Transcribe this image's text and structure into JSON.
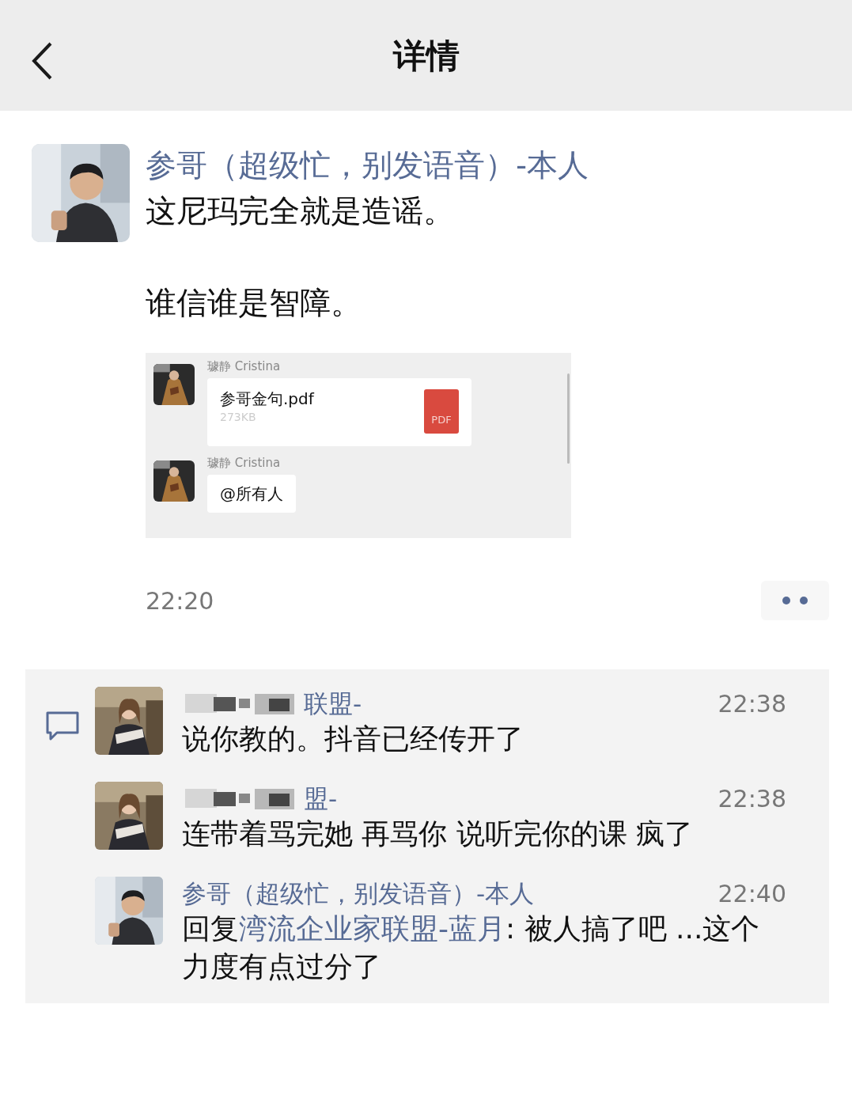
{
  "header": {
    "title": "详情"
  },
  "post": {
    "author": "参哥（超级忙，别发语音）-本人",
    "paragraphs": [
      "这尼玛完全就是造谣。",
      "谁信谁是智障。"
    ],
    "screenshot": {
      "messages": [
        {
          "kind": "file",
          "sender": "璩静 Cristina",
          "file_name": "参哥金句.pdf",
          "file_size": "273KB",
          "file_badge": "PDF"
        },
        {
          "kind": "text",
          "sender": "璩静 Cristina",
          "text": "@所有人"
        }
      ]
    },
    "time": "22:20"
  },
  "comments": [
    {
      "kind": "plain",
      "name": "联盟-",
      "name_blurred": true,
      "time": "22:38",
      "text": "说你教的。抖音已经传开了"
    },
    {
      "kind": "plain",
      "name": "盟-",
      "name_blurred": true,
      "time": "22:38",
      "text": "连带着骂完她 再骂你 说听完你的课 疯了"
    },
    {
      "kind": "reply",
      "name": "参哥（超级忙，别发语音）-本人",
      "name_blurred": false,
      "time": "22:40",
      "reply_prefix": "回复",
      "reply_target": "湾流企业家联盟-蓝月",
      "text": ": 被人搞了吧 ...这个力度有点过分了"
    }
  ]
}
